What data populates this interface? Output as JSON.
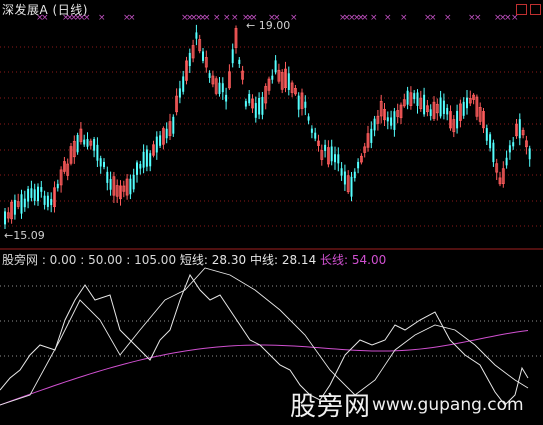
{
  "main_title": "深发展A (日线)",
  "price_labels": {
    "high": "19.00",
    "low": "15.09"
  },
  "sub_header": {
    "prefix": "股旁网 : 0.00 : 50.00 : 105.00",
    "short_label": "短线:",
    "short_value": "28.30",
    "mid_label": "中线:",
    "mid_value": "28.14",
    "long_label": "长线:",
    "long_value": "54.00"
  },
  "watermark": {
    "text": "股旁网",
    "url": "www.gupang.com"
  },
  "colors": {
    "up": "#ff5c5c",
    "down": "#54ffff",
    "long_line": "#d050d0",
    "grid_red": "#8b1a1a",
    "white": "#e8e8e8"
  },
  "icons": {
    "nav_prev": "square-icon",
    "nav_next": "square-icon"
  }
}
